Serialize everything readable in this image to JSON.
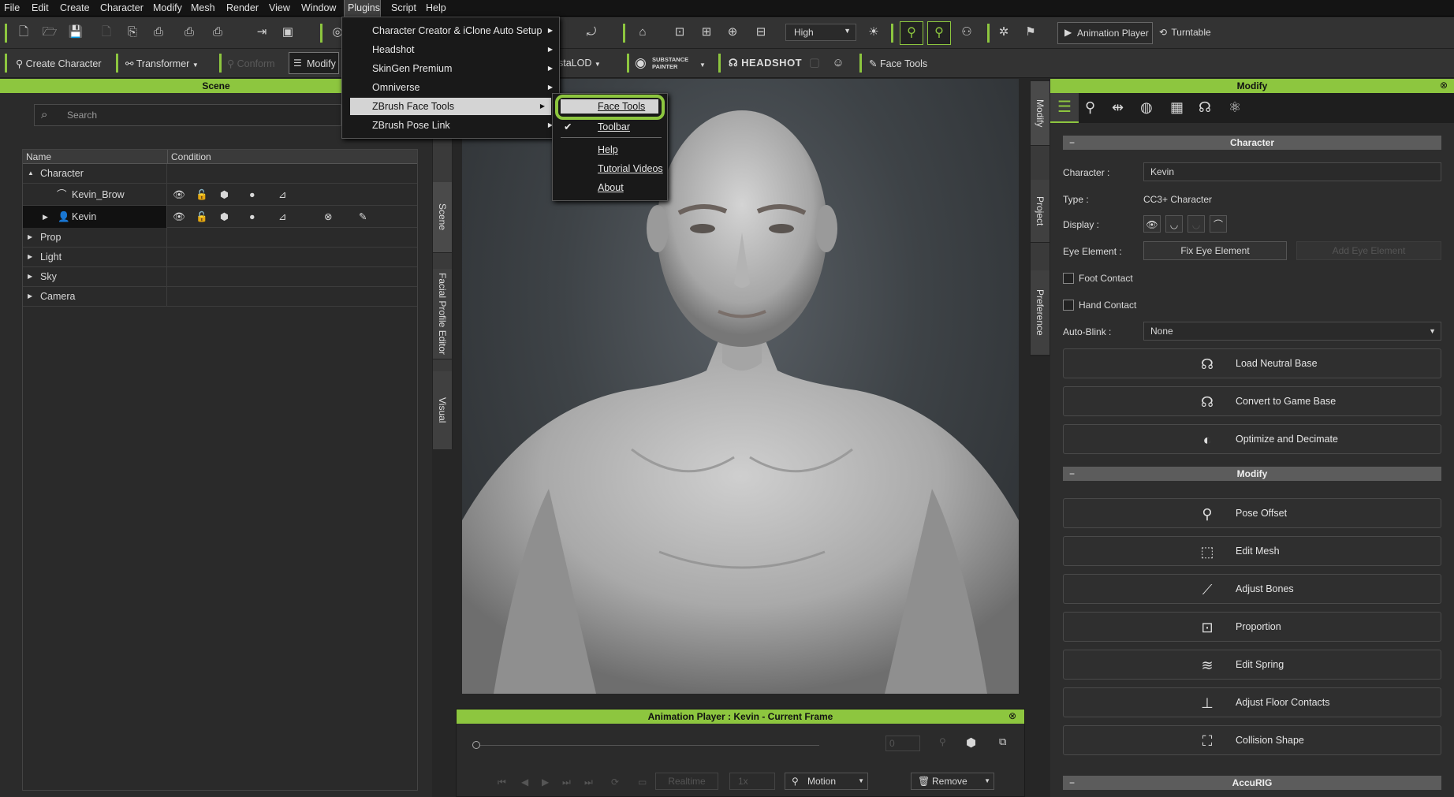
{
  "menubar": {
    "items": [
      "File",
      "Edit",
      "Create",
      "Character",
      "Modify",
      "Mesh",
      "Render",
      "View",
      "Window",
      "Plugins",
      "Script",
      "Help"
    ],
    "active": "Plugins"
  },
  "toolbar1": {
    "quality_value": "High",
    "animation_player_label": "Animation Player",
    "turntable_label": "Turntable"
  },
  "toolbar2": {
    "create_character": "Create Character",
    "transformer": "Transformer",
    "conform": "Conform",
    "modify": "Modify",
    "instalod": "staLOD",
    "substance_painter": "SUBSTANCE PAINTER",
    "headshot": "HEADSHOT",
    "face_tools": "Face Tools"
  },
  "plugins_menu": {
    "items": [
      {
        "label": "Character Creator & iClone Auto Setup",
        "submenu": true
      },
      {
        "label": "Headshot",
        "submenu": true
      },
      {
        "label": "SkinGen Premium",
        "submenu": true
      },
      {
        "label": "Omniverse",
        "submenu": true
      },
      {
        "label": "ZBrush Face Tools",
        "submenu": true
      },
      {
        "label": "ZBrush Pose Link",
        "submenu": true
      }
    ],
    "highlighted": "ZBrush Face Tools"
  },
  "zbrush_submenu": {
    "items": [
      {
        "label": "Face Tools",
        "checked": false
      },
      {
        "label": "Toolbar",
        "checked": true
      },
      {
        "label": "Help",
        "checked": false
      },
      {
        "label": "Tutorial Videos",
        "checked": false
      },
      {
        "label": "About",
        "checked": false
      }
    ],
    "highlighted": "Face Tools"
  },
  "scene": {
    "title": "Scene",
    "search_placeholder": "Search",
    "columns": [
      "Name",
      "Condition"
    ],
    "rows": [
      {
        "label": "Character",
        "expander": "▲"
      },
      {
        "label": "Kevin_Brow",
        "expander": ""
      },
      {
        "label": "Kevin",
        "expander": "▶"
      },
      {
        "label": "Prop",
        "expander": "▶"
      },
      {
        "label": "Light",
        "expander": "▶"
      },
      {
        "label": "Sky",
        "expander": "▶"
      },
      {
        "label": "Camera",
        "expander": "▶"
      }
    ]
  },
  "left_vtabs": [
    "Scene",
    "Facial Profile Editor",
    "Visual"
  ],
  "right_vtabs": [
    "Modify",
    "Project",
    "Preference"
  ],
  "animation_player": {
    "title": "Animation Player : Kevin - Current Frame",
    "frame": "0",
    "realtime": "Realtime",
    "speed": "1x",
    "motion": "Motion",
    "remove": "Remove"
  },
  "modify_panel": {
    "title": "Modify",
    "character_section": "Character",
    "character_label": "Character :",
    "character_value": "Kevin",
    "type_label": "Type :",
    "type_value": "CC3+ Character",
    "display_label": "Display :",
    "eye_element_label": "Eye Element :",
    "fix_eye_element": "Fix Eye Element",
    "add_eye_element": "Add Eye Element",
    "foot_contact": "Foot Contact",
    "hand_contact": "Hand Contact",
    "auto_blink_label": "Auto-Blink :",
    "auto_blink_value": "None",
    "character_buttons": [
      "Load Neutral Base",
      "Convert to Game Base",
      "Optimize and Decimate"
    ],
    "modify_section": "Modify",
    "modify_buttons": [
      "Pose Offset",
      "Edit Mesh",
      "Adjust Bones",
      "Proportion",
      "Edit Spring",
      "Adjust Floor Contacts",
      "Collision Shape"
    ],
    "accurig_section": "AccuRIG"
  },
  "colors": {
    "accent": "#8dc63f",
    "background": "#2b2b2b",
    "menubar": "#141414"
  }
}
